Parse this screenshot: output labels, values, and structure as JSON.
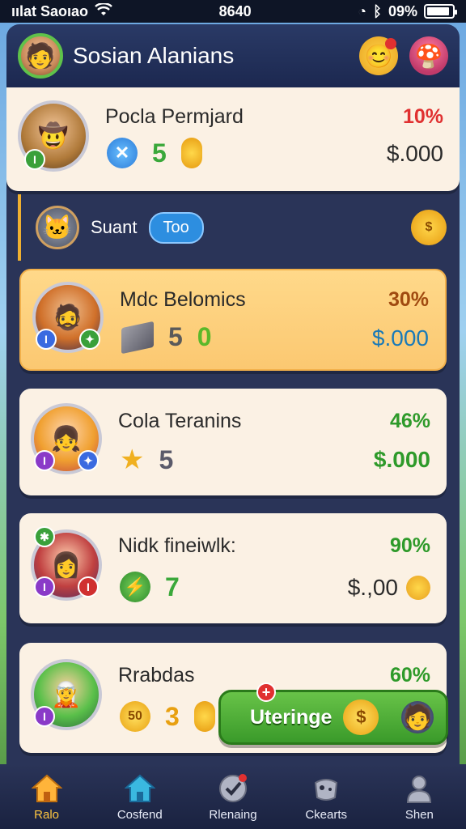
{
  "status_bar": {
    "carrier": "ıılat Saoıao",
    "time": "8640",
    "battery": "09%",
    "battery_level": 0.9
  },
  "header": {
    "title": "Sosian Alanians",
    "avatar_icon": "hero-avatar"
  },
  "section": {
    "label": "Suant",
    "pill": "Too",
    "coin_symbol": "$"
  },
  "cards": [
    {
      "name": "Pocla Permjard",
      "percent": "10%",
      "percent_color": "#e03030",
      "value": "$.000",
      "value_color": "#2a2a2a",
      "stat1": "5",
      "stat2": "",
      "icon1": "x-icon",
      "icon2": "coin-icon"
    },
    {
      "name": "Mdc Belomics",
      "percent": "30%",
      "percent_color": "#a04a10",
      "value": "$.000",
      "value_color": "#1a7ab8",
      "stat1": "5",
      "stat2": "0",
      "icon1": "cube-icon"
    },
    {
      "name": "Cola Teranins",
      "percent": "46%",
      "percent_color": "#2e9a2a",
      "value": "$.000",
      "value_color": "#2e9a2a",
      "stat1": "5",
      "stat2": "",
      "icon1": "star-icon"
    },
    {
      "name": "Nidk fineiwlk:",
      "percent": "90%",
      "percent_color": "#2e9a2a",
      "value": "$.,00",
      "value_color": "#2a2a2a",
      "stat1": "7",
      "stat2": "",
      "icon1": "leaf-icon"
    },
    {
      "name": "Rrabdas",
      "percent": "60%",
      "percent_color": "#2e9a2a",
      "value": "",
      "stat1": "3",
      "coin_label": "50",
      "icon1": "coin-icon"
    }
  ],
  "float_button": {
    "label": "Uteringe",
    "coin_symbol": "$",
    "badge": "+"
  },
  "nav": [
    {
      "label": "Ralo",
      "icon": "home-icon",
      "active": true
    },
    {
      "label": "Cosfend",
      "icon": "home-icon",
      "active": false
    },
    {
      "label": "Rlenaing",
      "icon": "check-icon",
      "active": false
    },
    {
      "label": "Ckearts",
      "icon": "controller-icon",
      "active": false
    },
    {
      "label": "Shen",
      "icon": "user-icon",
      "active": false
    }
  ],
  "colors": {
    "header_bg": "#2a3a66",
    "card_bg": "#fbf1e4",
    "highlight_card_bg": "#ffd98a",
    "nav_active": "#ffc640",
    "button_green": "#3a9a2a"
  }
}
